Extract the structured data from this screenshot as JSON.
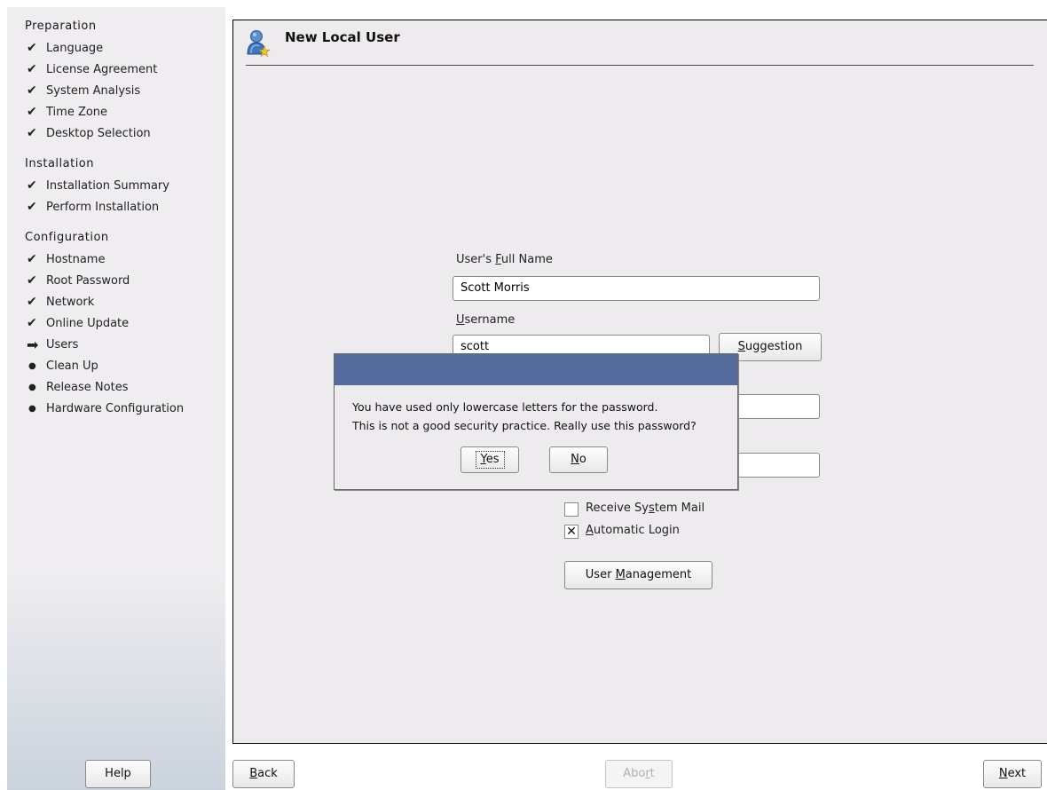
{
  "sidebar": {
    "sections": [
      {
        "title": "Preparation",
        "steps": [
          {
            "label": "Language",
            "status": "done"
          },
          {
            "label": "License Agreement",
            "status": "done"
          },
          {
            "label": "System Analysis",
            "status": "done"
          },
          {
            "label": "Time Zone",
            "status": "done"
          },
          {
            "label": "Desktop Selection",
            "status": "done"
          }
        ]
      },
      {
        "title": "Installation",
        "steps": [
          {
            "label": "Installation Summary",
            "status": "done"
          },
          {
            "label": "Perform Installation",
            "status": "done"
          }
        ]
      },
      {
        "title": "Configuration",
        "steps": [
          {
            "label": "Hostname",
            "status": "done"
          },
          {
            "label": "Root Password",
            "status": "done"
          },
          {
            "label": "Network",
            "status": "done"
          },
          {
            "label": "Online Update",
            "status": "done"
          },
          {
            "label": "Users",
            "status": "current"
          },
          {
            "label": "Clean Up",
            "status": "pending"
          },
          {
            "label": "Release Notes",
            "status": "pending"
          },
          {
            "label": "Hardware Configuration",
            "status": "pending"
          }
        ]
      }
    ]
  },
  "main": {
    "title": "New Local User",
    "icon": "user-add-icon",
    "full_name": {
      "label_pre": "User's ",
      "label_accel": "F",
      "label_post": "ull Name",
      "value": "Scott Morris"
    },
    "username": {
      "label_pre": "",
      "label_accel": "U",
      "label_post": "sername",
      "value": "scott"
    },
    "suggestion_button": {
      "label_pre": "",
      "label_accel": "S",
      "label_post": "uggestion"
    },
    "receive_mail": {
      "label_pre": "Receive Sy",
      "label_accel": "s",
      "label_post": "tem Mail",
      "checked": false
    },
    "auto_login": {
      "label_pre": "",
      "label_accel": "A",
      "label_post": "utomatic Login",
      "checked": true
    },
    "user_management_button": {
      "label_pre": "User ",
      "label_accel": "M",
      "label_post": "anagement"
    }
  },
  "dialog": {
    "line1": "You have used only lowercase letters for the password.",
    "line2": "This is not a good security practice. Really use this password?",
    "yes": {
      "label_pre": "",
      "label_accel": "Y",
      "label_post": "es"
    },
    "no": {
      "label_pre": "",
      "label_accel": "N",
      "label_post": "o"
    }
  },
  "footer": {
    "help": "Help",
    "back": {
      "label_pre": "",
      "label_accel": "B",
      "label_post": "ack"
    },
    "abort": {
      "label_pre": "Abo",
      "label_accel": "r",
      "label_post": "t",
      "enabled": false
    },
    "next": {
      "label_pre": "",
      "label_accel": "N",
      "label_post": "ext"
    }
  },
  "colors": {
    "dialog_titlebar": "#536b9d",
    "panel_bg": "#eeebef"
  }
}
